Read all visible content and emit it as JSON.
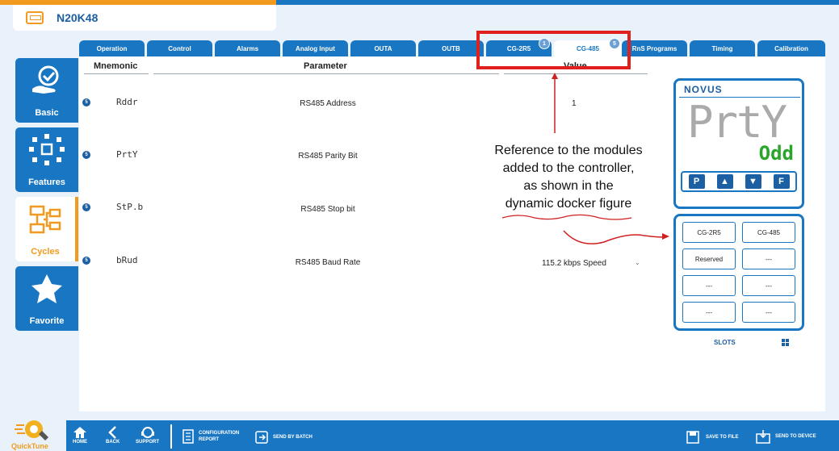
{
  "device": {
    "name": "N20K48"
  },
  "tabs": [
    {
      "label": "Operation"
    },
    {
      "label": "Control"
    },
    {
      "label": "Alarms"
    },
    {
      "label": "Analog Input"
    },
    {
      "label": "OUTA"
    },
    {
      "label": "OUTB"
    },
    {
      "label": "CG-2R5",
      "badge": "1"
    },
    {
      "label": "CG-485",
      "badge": "5",
      "active": true
    },
    {
      "label": "RnS Programs"
    },
    {
      "label": "Timing"
    },
    {
      "label": "Calibration"
    }
  ],
  "sidebar": {
    "items": [
      {
        "label": "Basic",
        "icon": "hand-check-icon"
      },
      {
        "label": "Features",
        "icon": "network-icon"
      },
      {
        "label": "Cycles",
        "icon": "flowchart-icon",
        "active": true
      },
      {
        "label": "Favorite",
        "icon": "star-icon"
      }
    ]
  },
  "table": {
    "headers": {
      "mnemonic": "Mnemonic",
      "parameter": "Parameter",
      "value": "Value"
    },
    "rows": [
      {
        "badge": "5",
        "mnemonic": "Rddr",
        "parameter": "RS485 Address",
        "value": "1"
      },
      {
        "badge": "5",
        "mnemonic": "PrtY",
        "parameter": "RS485 Parity Bit",
        "value": ""
      },
      {
        "badge": "5",
        "mnemonic": "StP.b",
        "parameter": "RS485 Stop bit",
        "value": ""
      },
      {
        "badge": "5",
        "mnemonic": "bRud",
        "parameter": "RS485 Baud Rate",
        "value": "115.2 kbps Speed"
      }
    ]
  },
  "annotation": {
    "line1": "Reference to the modules",
    "line2": "added to the controller,",
    "line3": "as shown in the",
    "line4": "dynamic docker figure"
  },
  "display": {
    "brand": "NOVUS",
    "main": "PrtY",
    "sub": "Odd",
    "keys": [
      "P",
      "▲",
      "▼",
      "F"
    ]
  },
  "slots": {
    "label": "SLOTS",
    "items": [
      "CG-2R5",
      "CG-485",
      "Reserved",
      "---",
      "---",
      "---",
      "---",
      "---"
    ]
  },
  "bottombar": {
    "logo": "QuickTune",
    "home": "HOME",
    "back": "BACK",
    "support": "SUPPORT",
    "config_report": "CONFIGURATION REPORT",
    "send_batch": "SEND BY BATCH",
    "save_file": "SAVE TO FILE",
    "send_device": "SEND TO DEVICE"
  },
  "colors": {
    "primary": "#1976c3",
    "accent": "#f29a1f",
    "highlight": "#e0201c",
    "display_green": "#2aa52a"
  }
}
